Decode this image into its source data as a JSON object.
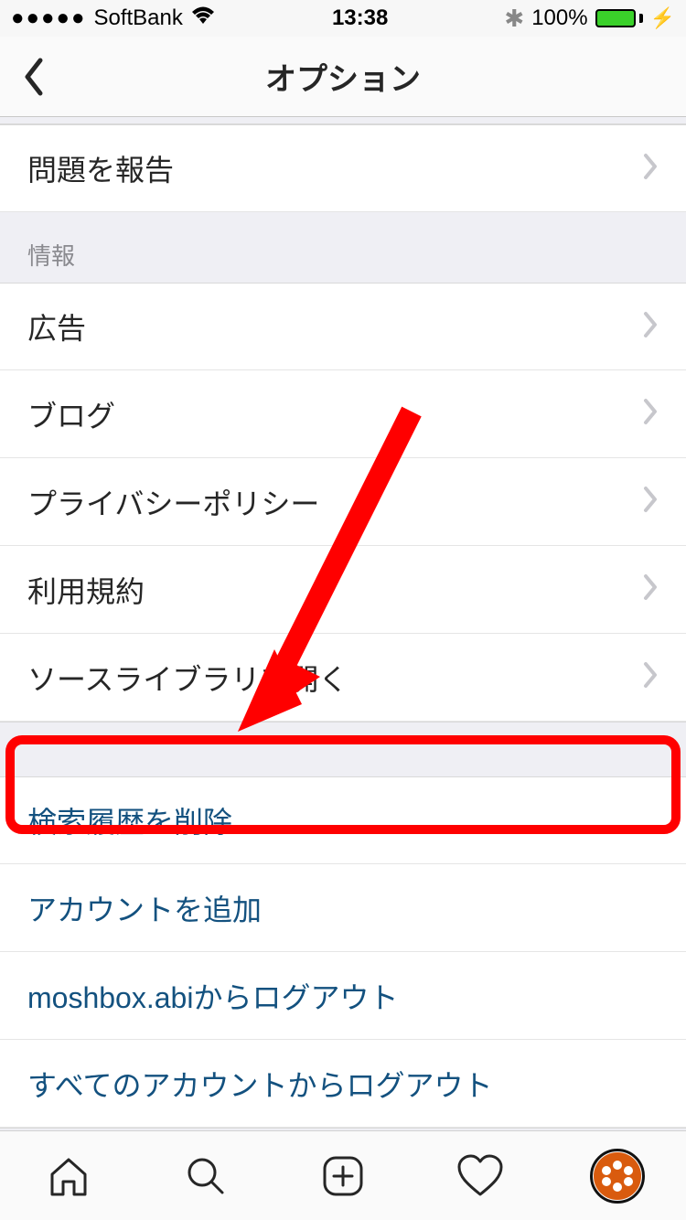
{
  "status": {
    "carrier": "SoftBank",
    "time": "13:38",
    "battery_pct": "100%"
  },
  "nav": {
    "title": "オプション"
  },
  "rows": {
    "report": "問題を報告",
    "info_header": "情報",
    "ads": "広告",
    "blog": "ブログ",
    "privacy": "プライバシーポリシー",
    "terms": "利用規約",
    "open_source": "ソースライブラリを開く",
    "clear_search": "検索履歴を削除",
    "add_account": "アカウントを追加",
    "logout_user": "moshbox.abiからログアウト",
    "logout_all": "すべてのアカウントからログアウト"
  }
}
